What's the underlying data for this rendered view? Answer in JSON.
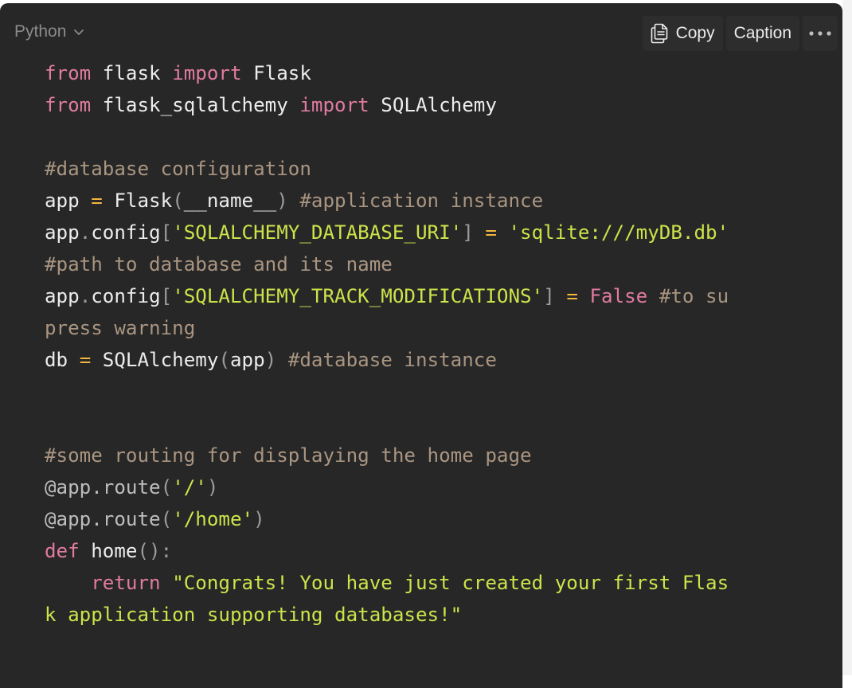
{
  "header": {
    "language": "Python",
    "copy_label": "Copy",
    "caption_label": "Caption",
    "more_label": "•••"
  },
  "code": {
    "l1": {
      "a": "from",
      "b": " flask ",
      "c": "import",
      "d": " Flask"
    },
    "l2": {
      "a": "from",
      "b": " flask_sqlalchemy ",
      "c": "import",
      "d": " SQLAlchemy"
    },
    "l3": {},
    "l4": {
      "a": "#database configuration"
    },
    "l5": {
      "a": "app ",
      "b": "=",
      "c": " Flask",
      "d": "(",
      "e": "__name__",
      "f": ")",
      "g": " ",
      "h": "#application instance"
    },
    "l6": {
      "a": "app",
      "b": ".",
      "c": "config",
      "d": "[",
      "e": "'SQLALCHEMY_DATABASE_URI'",
      "f": "]",
      "g": " ",
      "h": "=",
      "i": " ",
      "j": "'sqlite:///myDB.db'"
    },
    "l7": {
      "a": "#path to database and its name"
    },
    "l8": {
      "a": "app",
      "b": ".",
      "c": "config",
      "d": "[",
      "e": "'SQLALCHEMY_TRACK_MODIFICATIONS'",
      "f": "]",
      "g": " ",
      "h": "=",
      "i": " ",
      "j": "False",
      "k": " ",
      "l": "#to su"
    },
    "l9": {
      "a": "press warning"
    },
    "l10": {
      "a": "db ",
      "b": "=",
      "c": " SQLAlchemy",
      "d": "(",
      "e": "app",
      "f": ")",
      "g": " ",
      "h": "#database instance"
    },
    "l11": {},
    "l12": {},
    "l13": {
      "a": "#some routing for displaying the home page"
    },
    "l14": {
      "a": "@app.route",
      "b": "(",
      "c": "'/'",
      "d": ")"
    },
    "l15": {
      "a": "@app.route",
      "b": "(",
      "c": "'/home'",
      "d": ")"
    },
    "l16": {
      "a": "def",
      "b": " home",
      "c": "():",
      "d": ""
    },
    "l17": {
      "a": "    ",
      "b": "return",
      "c": " ",
      "d": "\"Congrats! You have just created your first Flas"
    },
    "l18": {
      "a": "k application supporting databases!\""
    }
  },
  "colors": {
    "background": "#272727",
    "keyword": "#e07ba0",
    "string": "#cde34a",
    "comment": "#a99581",
    "operator": "#f4b63f",
    "text": "#ececec"
  },
  "icons": {
    "chevron": "chevron-down-icon",
    "copy": "copy-icon",
    "more": "ellipsis-icon"
  }
}
